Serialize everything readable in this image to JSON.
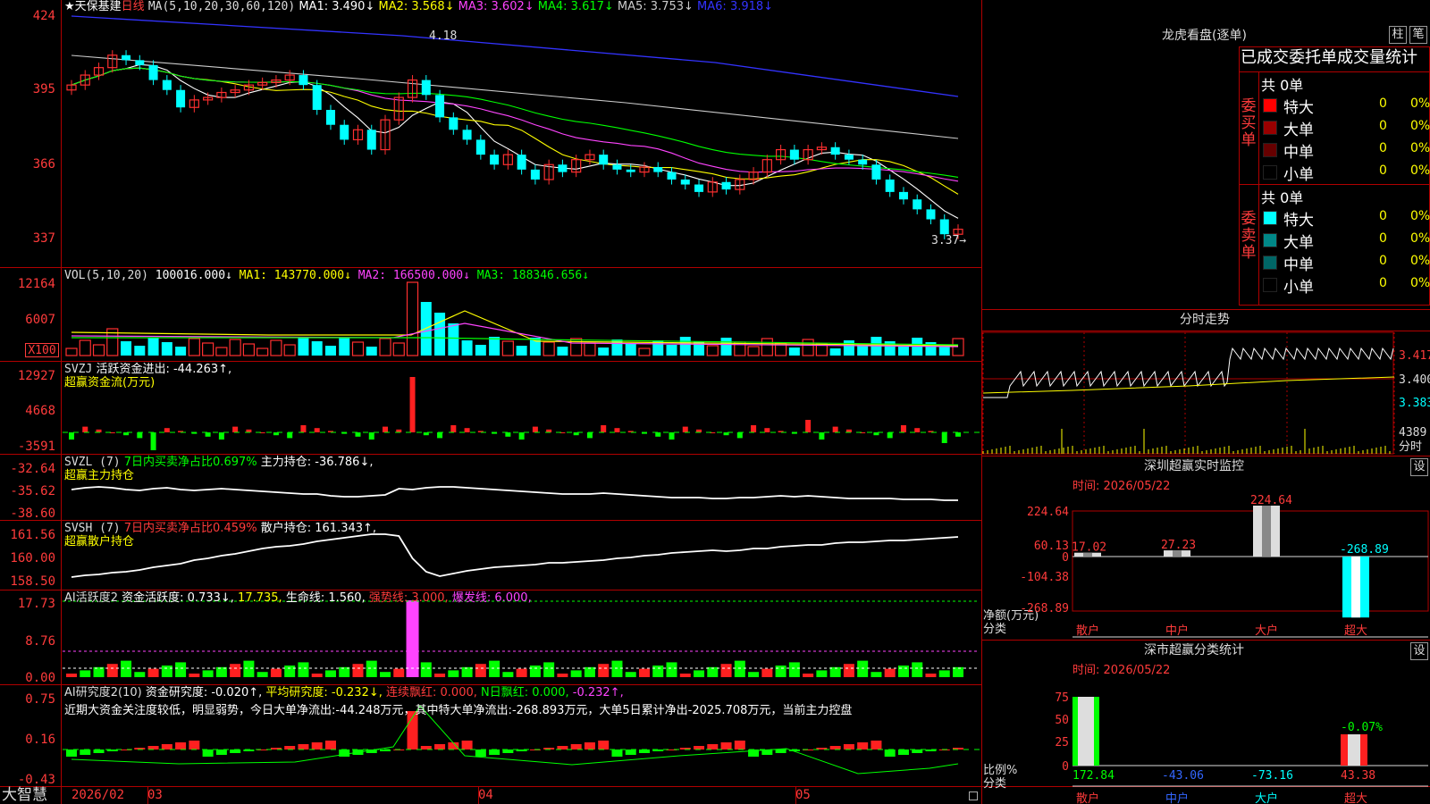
{
  "stock": {
    "name": "天保基建",
    "star": "★",
    "period": "日线"
  },
  "main_chart": {
    "ma_label": "MA(5,10,20,30,60,120)",
    "ma_items": [
      {
        "label": "MA1: 3.490↓",
        "color": "#ffffff"
      },
      {
        "label": "MA2: 3.568↓",
        "color": "#ffff00"
      },
      {
        "label": "MA3: 3.602↓",
        "color": "#ff44ff"
      },
      {
        "label": "MA4: 3.617↓",
        "color": "#00ff00"
      },
      {
        "label": "MA5: 3.753↓",
        "color": "#cccccc"
      },
      {
        "label": "MA6: 3.918↓",
        "color": "#3333ff"
      }
    ],
    "yticks": [
      "424",
      "395",
      "366",
      "337"
    ],
    "high_marker": "4.18",
    "low_marker": "3.37→"
  },
  "vol_panel": {
    "title": "VOL(5,10,20)",
    "value": "100016.000↓",
    "items": [
      {
        "label": "MA1: 143770.000↓",
        "color": "#ffff00"
      },
      {
        "label": "MA2: 166500.000↓",
        "color": "#ff44ff"
      },
      {
        "label": "MA3: 188346.656↓",
        "color": "#00ff00"
      }
    ],
    "yticks": [
      "12164",
      "6007"
    ],
    "unit": "X100"
  },
  "svzj_panel": {
    "title": "SVZJ",
    "line1": "活跃资金进出: -44.263↑,",
    "line2": "超赢资金流(万元)",
    "yticks": [
      "12927",
      "4668",
      "-3591"
    ]
  },
  "svzl_panel": {
    "title": "SVZL (7)",
    "ratio": "7日内买卖净占比0.697%",
    "hold": "主力持仓: -36.786↓,",
    "line2": "超赢主力持仓",
    "yticks": [
      "-32.64",
      "-35.62",
      "-38.60"
    ]
  },
  "svsh_panel": {
    "title": "SVSH (7)",
    "ratio": "7日内买卖净占比0.459%",
    "hold": "散户持仓: 161.343↑,",
    "line2": "超赢散户持仓",
    "yticks": [
      "161.56",
      "160.00",
      "158.50"
    ]
  },
  "ai_active_panel": {
    "title": "AI活跃度2",
    "v1": "资金活跃度: 0.733↓,",
    "v2": "17.735,",
    "v3": "生命线: 1.560,",
    "v4": "强势线: 3.000,",
    "v5": "爆发线: 6.000,",
    "yticks": [
      "17.73",
      "8.76",
      "0.00"
    ]
  },
  "ai_research_panel": {
    "title": "AI研究度2(10)",
    "v1": "资金研究度: -0.020↑,",
    "v2": "平均研究度: -0.232↓,",
    "v3": "连续飘红: 0.000,",
    "v4": "N日飘红: 0.000,",
    "v5": "-0.232↑,",
    "summary": "近期大资金关注度较低，明显弱势，今日大单净流出:-44.248万元，其中特大单净流出:-268.893万元，大单5日累计净出-2025.708万元，当前主力控盘",
    "yticks": [
      "0.75",
      "0.16",
      "-0.43"
    ]
  },
  "bottom_bar": {
    "brand": "大智慧",
    "dates": [
      "2026/02",
      "03",
      "04",
      "05"
    ]
  },
  "dragon_tiger": {
    "title": "龙虎看盘(逐单)",
    "btn1": "柱",
    "btn2": "笔",
    "table_title": "已成交委托单成交量统计",
    "buy": {
      "side_label": "委买单",
      "total": "共 0单",
      "rows": [
        {
          "label": "特大",
          "value": "0",
          "pct": "0%",
          "color": "#ff0000"
        },
        {
          "label": "大单",
          "value": "0",
          "pct": "0%",
          "color": "#990000"
        },
        {
          "label": "中单",
          "value": "0",
          "pct": "0%",
          "color": "#660000"
        },
        {
          "label": "小单",
          "value": "0",
          "pct": "0%",
          "color": "#000000"
        }
      ]
    },
    "sell": {
      "side_label": "委卖单",
      "total": "共 0单",
      "rows": [
        {
          "label": "特大",
          "value": "0",
          "pct": "0%",
          "color": "#00ffff"
        },
        {
          "label": "大单",
          "value": "0",
          "pct": "0%",
          "color": "#008888"
        },
        {
          "label": "中单",
          "value": "0",
          "pct": "0%",
          "color": "#006666"
        },
        {
          "label": "小单",
          "value": "0",
          "pct": "0%",
          "color": "#000000"
        }
      ]
    }
  },
  "intraday": {
    "title": "分时走势",
    "prices": [
      "3.417",
      "3.400",
      "3.383"
    ],
    "volume_max": "4389",
    "volume_label": "分时"
  },
  "sz_monitor": {
    "title": "深圳超赢实时监控",
    "settings": "设",
    "time": "时间: 2026/05/22",
    "yticks": [
      "224.64",
      "60.13",
      "0",
      "-104.38",
      "-268.89"
    ],
    "ylabel": "净额(万元)",
    "xlabel": "分类",
    "categories": [
      "散户",
      "中户",
      "大户",
      "超大"
    ],
    "values_text": [
      "17.02",
      "27.23",
      "224.64",
      "-268.89"
    ]
  },
  "sz_classify": {
    "title": "深市超赢分类统计",
    "settings": "设",
    "time": "时间: 2026/05/22",
    "yticks": [
      "75",
      "50",
      "25",
      "0"
    ],
    "ylabel": "比例%",
    "xlabel": "分类",
    "categories": [
      "散户",
      "中户",
      "大户",
      "超大"
    ],
    "values_text": [
      "172.84",
      "-43.06",
      "-73.16",
      "43.38"
    ],
    "top_label": "-0.07%"
  }
}
